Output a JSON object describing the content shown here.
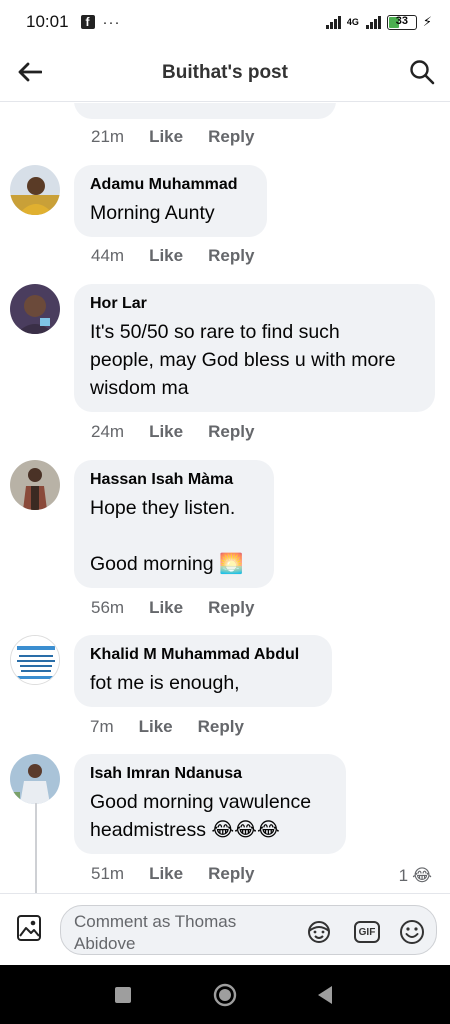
{
  "status_bar": {
    "time": "10:01",
    "notification_dots": "···",
    "network": "4G",
    "battery": "33"
  },
  "header": {
    "title": "Buithat's post"
  },
  "top_meta": {
    "time": "21m",
    "like": "Like",
    "reply": "Reply"
  },
  "comments": [
    {
      "author": "Adamu Muhammad",
      "lines": [
        "Morning Aunty"
      ],
      "time": "44m",
      "like": "Like",
      "reply": "Reply"
    },
    {
      "author": "Hor Lar",
      "lines": [
        "It's 50/50 so rare to find such",
        "people, may God bless u with more",
        "wisdom ma"
      ],
      "time": "24m",
      "like": "Like",
      "reply": "Reply"
    },
    {
      "author": "Hassan Isah Màma",
      "lines": [
        "Hope they listen.",
        "",
        "Good morning 🌅"
      ],
      "time": "56m",
      "like": "Like",
      "reply": "Reply"
    },
    {
      "author": "Khalid M Muhammad Abdul",
      "lines": [
        "fot me is enough,"
      ],
      "time": "7m",
      "like": "Like",
      "reply": "Reply"
    },
    {
      "author": "Isah Imran Ndanusa",
      "lines": [
        "Good morning vawulence",
        "headmistress 😂😂😂"
      ],
      "time": "51m",
      "like": "Like",
      "reply": "Reply",
      "reaction_count": "1",
      "reaction_emoji": "😂"
    }
  ],
  "composer": {
    "placeholder_line1": "Comment as Thomas",
    "placeholder_line2": "Abidove",
    "gif_label": "GIF"
  },
  "icons": {
    "back": "arrow-left-icon",
    "search": "search-icon",
    "photo": "photo-icon",
    "avatar_sticker": "sticker-icon",
    "gif": "gif-icon",
    "emoji": "emoji-icon"
  },
  "colors": {
    "bubble_bg": "#f0f2f5",
    "meta_text": "#65676b",
    "battery_fill": "#4caf50"
  }
}
